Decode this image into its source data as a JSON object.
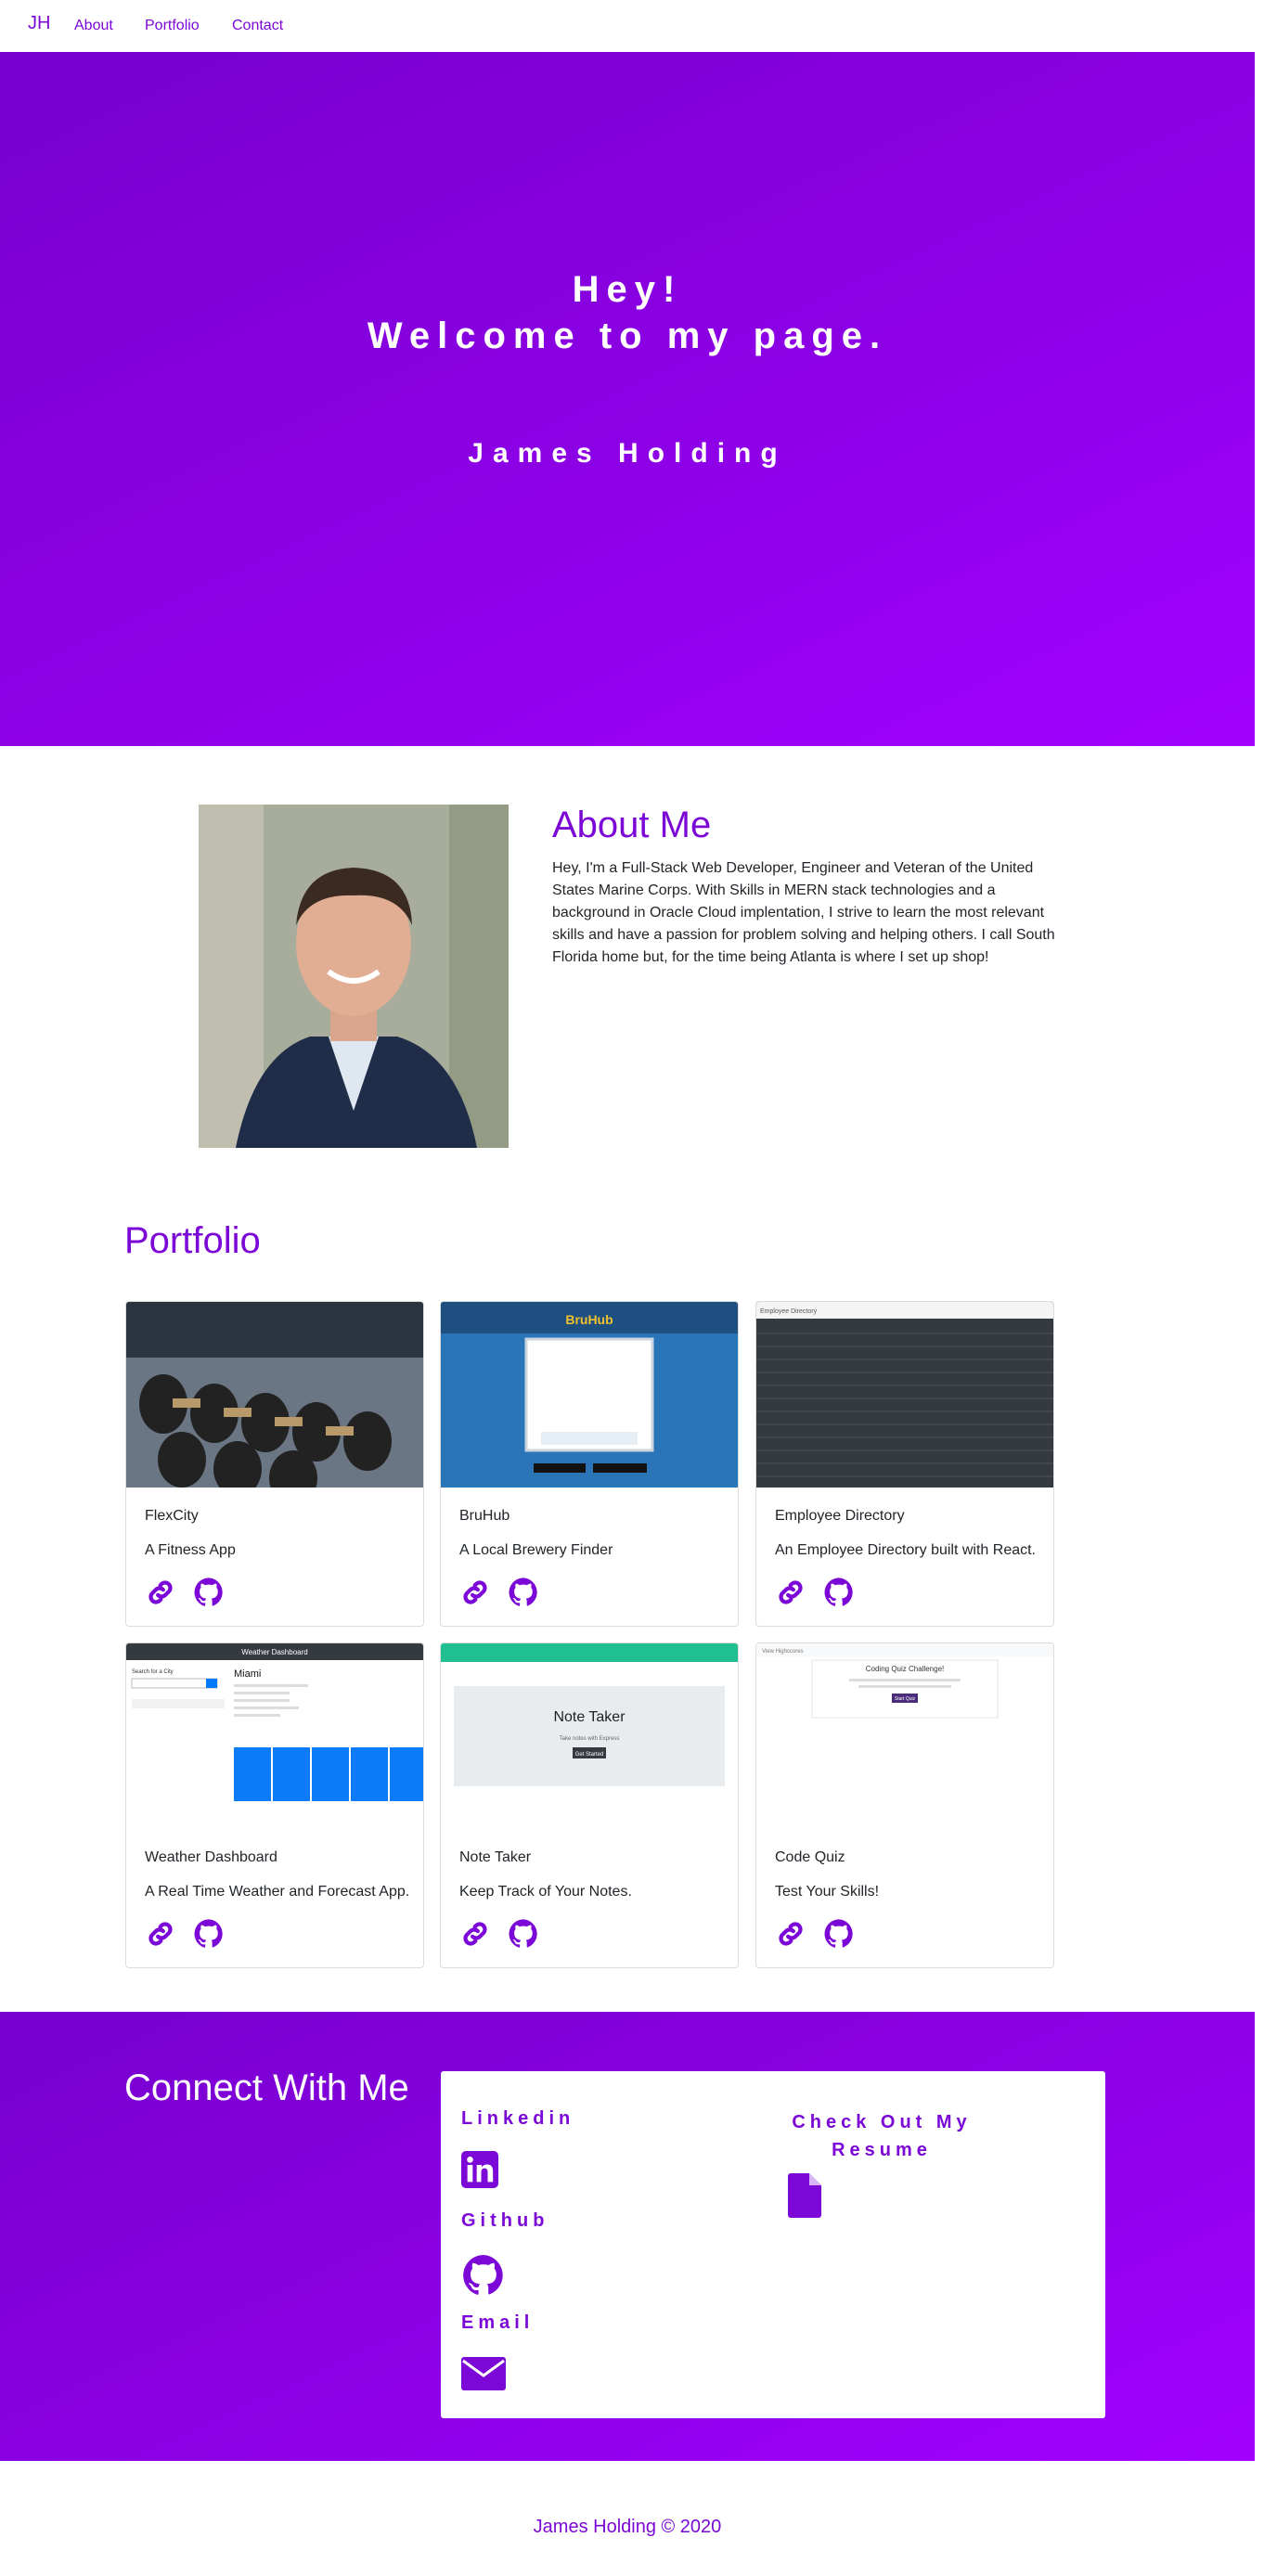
{
  "nav": {
    "brand": "JH",
    "links": [
      "About",
      "Portfolio",
      "Contact"
    ]
  },
  "hero": {
    "line1": "Hey!",
    "line2": "Welcome to my page.",
    "name": "James Holding"
  },
  "about": {
    "title": "About Me",
    "text": "Hey, I'm a Full-Stack Web Developer, Engineer and Veteran of the United States Marine Corps. With Skills in MERN stack technologies and a background in Oracle Cloud implentation, I strive to learn the most relevant skills and have a passion for problem solving and helping others. I call South Florida home but, for the time being Atlanta is where I set up shop!"
  },
  "portfolio": {
    "title": "Portfolio",
    "cards": [
      {
        "title": "FlexCity",
        "desc": "A Fitness App"
      },
      {
        "title": "BruHub",
        "desc": "A Local Brewery Finder"
      },
      {
        "title": "Employee Directory",
        "desc": "An Employee Directory built with React."
      },
      {
        "title": "Weather Dashboard",
        "desc": "A Real Time Weather and Forecast App."
      },
      {
        "title": "Note Taker",
        "desc": "Keep Track of Your Notes."
      },
      {
        "title": "Code Quiz",
        "desc": "Test Your Skills!"
      }
    ],
    "thumbs": {
      "bruhub_logo": "BruHub",
      "employee_header": "Employee Directory",
      "weather_header": "Weather Dashboard",
      "weather_search": "Search for a City",
      "weather_city": "Miami",
      "note_title": "Note Taker",
      "note_sub": "Take notes with Express",
      "note_btn": "Get Started",
      "quiz_title": "Coding Quiz Challenge!",
      "quiz_btn": "Start Quiz",
      "quiz_nav": "View Highscores"
    }
  },
  "connect": {
    "title": "Connect With Me",
    "linkedin": "Linkedin",
    "github": "Github",
    "email": "Email",
    "resume_l1": "Check Out My",
    "resume_l2": "Resume"
  },
  "footer": {
    "text": "James Holding © 2020"
  },
  "colors": {
    "accent": "#7b08d6",
    "hero_start": "#7700cf",
    "hero_end": "#a200ff"
  },
  "icons": [
    "link-icon",
    "github-icon",
    "linkedin-icon",
    "envelope-icon",
    "file-icon"
  ]
}
